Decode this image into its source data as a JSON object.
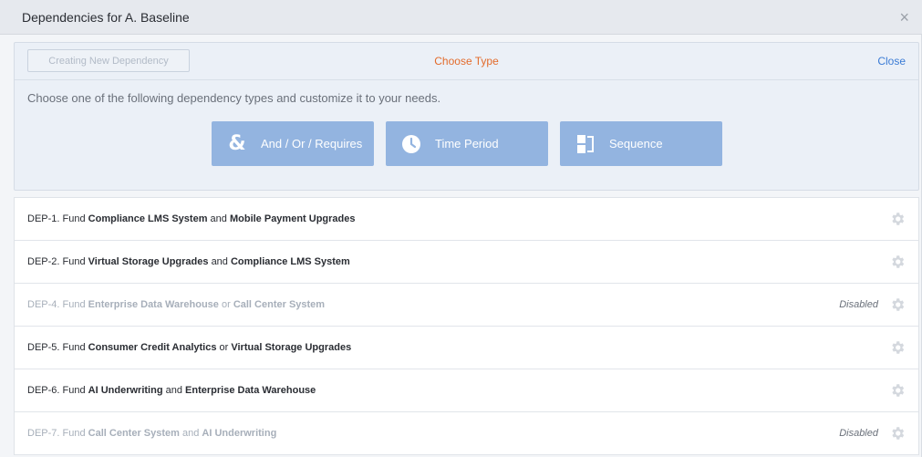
{
  "header": {
    "title": "Dependencies for A. Baseline",
    "close_glyph": "×"
  },
  "panel": {
    "creating_label": "Creating New Dependency",
    "choose_type_label": "Choose Type",
    "close_label": "Close",
    "instructions": "Choose one of the following dependency types and customize it to your needs.",
    "types": [
      {
        "label": "And / Or / Requires",
        "icon": "ampersand-icon",
        "icon_glyph": "&"
      },
      {
        "label": "Time Period",
        "icon": "clock-icon"
      },
      {
        "label": "Sequence",
        "icon": "sequence-icon"
      }
    ]
  },
  "colors": {
    "accent_orange": "#e36b2b",
    "link_blue": "#3a7bd5",
    "type_button_bg": "#93b4e0",
    "disabled_text": "#a7afba"
  },
  "dependencies": [
    {
      "prefix": "DEP-1. Fund ",
      "a": "Compliance LMS System",
      "op": " and ",
      "b": "Mobile Payment Upgrades",
      "status": ""
    },
    {
      "prefix": "DEP-2. Fund ",
      "a": "Virtual Storage Upgrades",
      "op": " and ",
      "b": "Compliance LMS System",
      "status": ""
    },
    {
      "prefix": "DEP-4. Fund ",
      "a": "Enterprise Data Warehouse",
      "op": " or ",
      "b": "Call Center System",
      "status": "Disabled"
    },
    {
      "prefix": "DEP-5. Fund ",
      "a": "Consumer Credit Analytics",
      "op": " or ",
      "b": "Virtual Storage Upgrades",
      "status": ""
    },
    {
      "prefix": "DEP-6. Fund ",
      "a": "AI Underwriting",
      "op": " and ",
      "b": "Enterprise Data Warehouse",
      "status": ""
    },
    {
      "prefix": "DEP-7. Fund ",
      "a": "Call Center System",
      "op": " and ",
      "b": "AI Underwriting",
      "status": "Disabled"
    }
  ]
}
